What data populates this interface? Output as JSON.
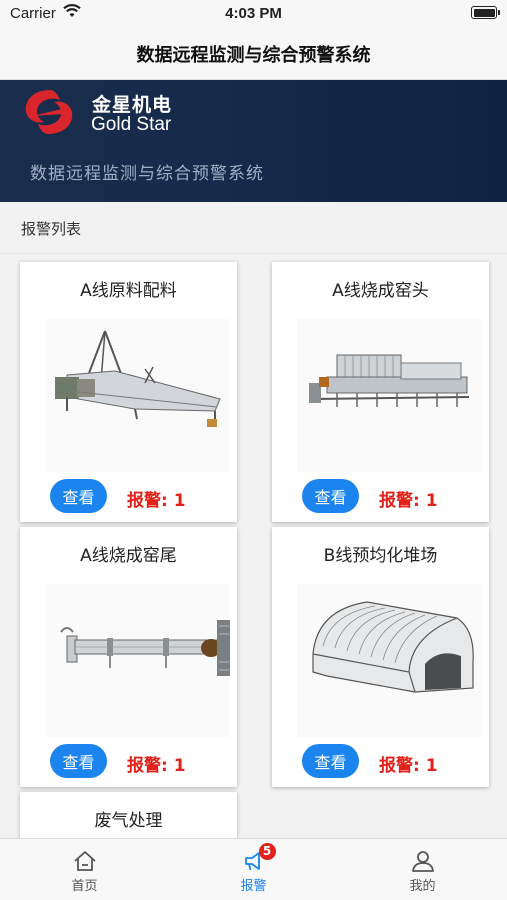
{
  "status_bar": {
    "carrier": "Carrier",
    "time": "4:03 PM"
  },
  "nav": {
    "title": "数据远程监测与综合预警系统"
  },
  "banner": {
    "brand_cn": "金星机电",
    "brand_en": "Gold Star",
    "subtitle": "数据远程监测与综合预警系统"
  },
  "section": {
    "label": "报警列表"
  },
  "cards": [
    {
      "title": "A线原料配料",
      "view_label": "查看",
      "alarm_text": "报警: 1",
      "image": "raw-material-batching-machine"
    },
    {
      "title": "A线烧成窑头",
      "view_label": "查看",
      "alarm_text": "报警: 1",
      "image": "kiln-head-machine"
    },
    {
      "title": "A线烧成窑尾",
      "view_label": "查看",
      "alarm_text": "报警: 1",
      "image": "rotary-kiln-tail"
    },
    {
      "title": "B线预均化堆场",
      "view_label": "查看",
      "alarm_text": "报警: 1",
      "image": "pre-homogenization-shed"
    },
    {
      "title": "废气处理"
    }
  ],
  "tabbar": {
    "items": [
      {
        "label": "首页",
        "icon": "home-icon",
        "active": false
      },
      {
        "label": "报警",
        "icon": "alarm-megaphone-icon",
        "active": true,
        "badge": "5"
      },
      {
        "label": "我的",
        "icon": "user-icon",
        "active": false
      }
    ]
  },
  "colors": {
    "accent": "#1b84ee",
    "alarm": "#e2221b",
    "banner": "#162a4b"
  }
}
